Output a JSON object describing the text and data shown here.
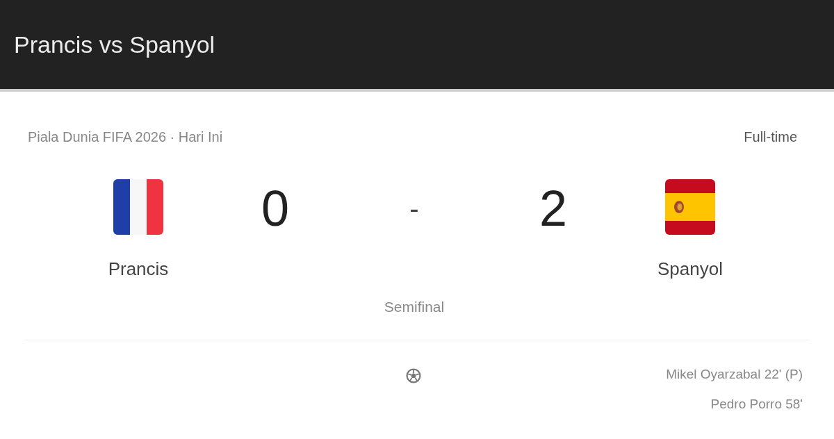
{
  "header": {
    "title": "Prancis vs Spanyol"
  },
  "match": {
    "meta": "Piala Dunia FIFA 2026 · Hari Ini",
    "status": "Full-time",
    "stage": "Semifinal",
    "score_separator": "-",
    "home": {
      "name": "Prancis",
      "score": "0"
    },
    "away": {
      "name": "Spanyol",
      "score": "2"
    },
    "away_goals": [
      "Mikel Oyarzabal 22' (P)",
      "Pedro Porro 58'"
    ]
  }
}
